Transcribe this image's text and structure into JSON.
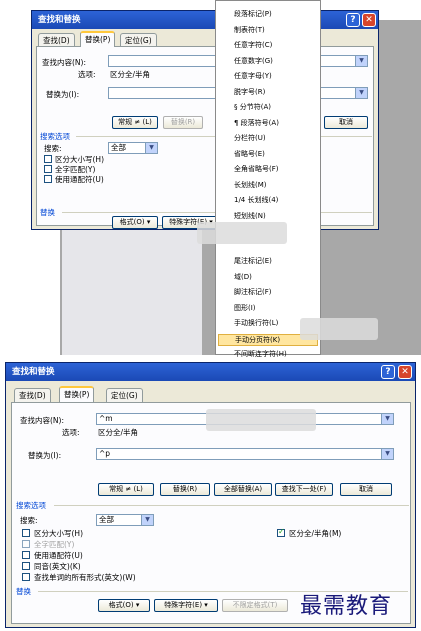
{
  "top": {
    "title": "查找和替换",
    "tabs": [
      "查找(D)",
      "替换(P)",
      "定位(G)"
    ],
    "find_label": "查找内容(N):",
    "options_label": "选项:",
    "options_value": "区分全/半角",
    "replace_label": "替换为(I):",
    "btn_more": "常规 ≠ (L)",
    "btn_replace": "替换(R)",
    "btn_cancel": "取消",
    "search_options": "搜索选项",
    "search_label": "搜索:",
    "search_value": "全部",
    "chk_case": "区分大小写(H)",
    "chk_whole": "全字匹配(Y)",
    "chk_wildcard": "使用通配符(U)",
    "replace_section": "替换",
    "btn_format": "格式(O) ▾",
    "btn_special": "特殊字符(E) ▾"
  },
  "menu_items": [
    "段落标记(P)",
    "制表符(T)",
    "任意字符(C)",
    "任意数字(G)",
    "任意字母(Y)",
    "脱字号(R)",
    "§ 分节符(A)",
    "¶ 段落符号(A)",
    "分栏符(U)",
    "省略号(E)",
    "全角省略号(F)",
    "长划线(M)",
    "1/4 长划线(4)",
    "短划线(N)",
    "尾注标记(E)",
    "域(D)",
    "脚注标记(F)",
    "图形(I)",
    "手动换行符(L)",
    "手动分页符(K)",
    "不间断连字符(H)"
  ],
  "bottom": {
    "title": "查找和替换",
    "tabs": [
      "查找(D)",
      "替换(P)",
      "定位(G)"
    ],
    "find_label": "查找内容(N):",
    "find_value": "^m",
    "options_label": "选项:",
    "options_value": "区分全/半角",
    "replace_label": "替换为(I):",
    "replace_value": "^p",
    "btn_more": "常规 ≠ (L)",
    "btn_replace": "替换(R)",
    "btn_replace_all": "全部替换(A)",
    "btn_find_next": "查找下一处(F)",
    "btn_cancel": "取消",
    "search_options": "搜索选项",
    "search_label": "搜索:",
    "search_value": "全部",
    "chk_case": "区分大小写(H)",
    "chk_whole": "全字匹配(Y)",
    "chk_wildcard": "使用通配符(U)",
    "chk_homophone": "同音(英文)(K)",
    "chk_forms": "查找单词的所有形式(英文)(W)",
    "chk_width": "区分全/半角(M)",
    "replace_section": "替换",
    "btn_format": "格式(O) ▾",
    "btn_special": "特殊字符(E) ▾",
    "btn_no_format": "不限定格式(T)"
  },
  "watermark": "最需教育"
}
